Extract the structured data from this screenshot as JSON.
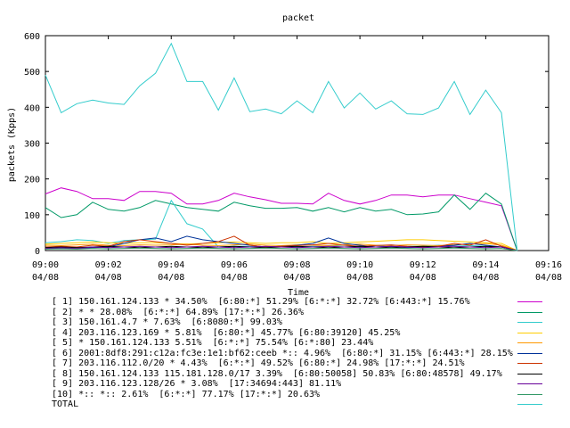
{
  "chart_data": {
    "type": "line",
    "title": "packet",
    "xlabel": "Time",
    "ylabel": "packets (Kpps)",
    "ylim": [
      0,
      600
    ],
    "yticks": [
      "0",
      "100",
      "200",
      "300",
      "400",
      "500",
      "600"
    ],
    "xlim": [
      "04/08 09:00",
      "04/08 09:16"
    ],
    "xticks": [
      {
        "time": "09:00",
        "date": "04/08"
      },
      {
        "time": "09:02",
        "date": "04/08"
      },
      {
        "time": "09:04",
        "date": "04/08"
      },
      {
        "time": "09:06",
        "date": "04/08"
      },
      {
        "time": "09:08",
        "date": "04/08"
      },
      {
        "time": "09:10",
        "date": "04/08"
      },
      {
        "time": "09:12",
        "date": "04/08"
      },
      {
        "time": "09:14",
        "date": "04/08"
      },
      {
        "time": "09:16",
        "date": "04/08"
      }
    ],
    "x": [
      "09:00:00",
      "09:00:30",
      "09:01:00",
      "09:01:30",
      "09:02:00",
      "09:02:30",
      "09:03:00",
      "09:03:30",
      "09:04:00",
      "09:04:30",
      "09:05:00",
      "09:05:30",
      "09:06:00",
      "09:06:30",
      "09:07:00",
      "09:07:30",
      "09:08:00",
      "09:08:30",
      "09:09:00",
      "09:09:30",
      "09:10:00",
      "09:10:30",
      "09:11:00",
      "09:11:30",
      "09:12:00",
      "09:12:30",
      "09:13:00",
      "09:13:30",
      "09:14:00",
      "09:14:30",
      "09:15:00"
    ],
    "grid": false,
    "legend_position": "bottom",
    "series": [
      {
        "name": "[ 1] 150.161.124.133 * 34.50%  [6:80:*] 51.29% [6:*:*] 32.72% [6:443:*] 15.76%",
        "color": "#cc00cc",
        "values": [
          158,
          175,
          165,
          145,
          145,
          140,
          165,
          165,
          160,
          130,
          130,
          140,
          160,
          150,
          142,
          132,
          132,
          130,
          160,
          140,
          130,
          140,
          155,
          155,
          150,
          155,
          155,
          145,
          135,
          125,
          0
        ]
      },
      {
        "name": "[ 2] * * 28.08%  [6:*:*] 64.89% [17:*:*] 26.36%",
        "color": "#009966",
        "values": [
          120,
          92,
          100,
          135,
          115,
          110,
          120,
          140,
          130,
          120,
          115,
          110,
          135,
          125,
          118,
          118,
          120,
          110,
          120,
          108,
          120,
          110,
          115,
          100,
          102,
          108,
          155,
          115,
          160,
          130,
          0
        ]
      },
      {
        "name": "[ 3] 150.161.4.7 * 7.63%  [6:8080:*] 99.03%",
        "color": "#33cccc",
        "values": [
          22,
          25,
          30,
          28,
          20,
          28,
          30,
          32,
          140,
          75,
          60,
          10,
          12,
          12,
          10,
          12,
          10,
          12,
          12,
          15,
          10,
          15,
          10,
          12,
          12,
          15,
          12,
          14,
          12,
          10,
          0
        ]
      },
      {
        "name": "[ 4] 203.116.123.169 * 5.81%  [6:80:*] 45.77% [6:80:39120] 45.25%",
        "color": "#ffcc00",
        "values": [
          18,
          20,
          22,
          24,
          22,
          20,
          22,
          22,
          20,
          18,
          20,
          22,
          24,
          22,
          20,
          22,
          22,
          25,
          20,
          22,
          24,
          26,
          28,
          30,
          30,
          28,
          26,
          24,
          22,
          20,
          0
        ]
      },
      {
        "name": "[ 5] * 150.161.124.133 5.51%  [6:*:*] 75.54% [6:*:80] 23.44%",
        "color": "#ff9900",
        "values": [
          15,
          14,
          16,
          18,
          15,
          14,
          16,
          15,
          16,
          18,
          15,
          14,
          16,
          18,
          15,
          14,
          16,
          15,
          14,
          16,
          18,
          15,
          14,
          16,
          15,
          14,
          16,
          18,
          20,
          15,
          0
        ]
      },
      {
        "name": "[ 6] 2001:8df8:291:c12a:fc3e:1e1:bf62:ceeb *:: 4.96%  [6:80:*] 31.15% [6:443:*] 28.15%",
        "color": "#003399",
        "values": [
          5,
          6,
          5,
          8,
          10,
          20,
          30,
          35,
          25,
          40,
          30,
          25,
          20,
          15,
          10,
          12,
          15,
          20,
          35,
          20,
          15,
          10,
          12,
          8,
          10,
          12,
          15,
          20,
          15,
          10,
          0
        ]
      },
      {
        "name": "[ 7] 203.116.112.0/20 * 4.43%  [6:*:*] 49.52% [6:80:*] 24.98% [17:*:*] 24.51%",
        "color": "#cc3300",
        "values": [
          10,
          12,
          10,
          15,
          12,
          25,
          30,
          25,
          20,
          15,
          20,
          25,
          40,
          15,
          10,
          12,
          14,
          16,
          20,
          15,
          12,
          14,
          16,
          12,
          10,
          12,
          20,
          15,
          30,
          12,
          0
        ]
      },
      {
        "name": "[ 8] 150.161.124.133 115.181.128.0/17 3.39%  [6:80:50058] 50.83% [6:80:48578] 49.17%",
        "color": "#000000",
        "values": [
          8,
          10,
          8,
          10,
          12,
          10,
          8,
          10,
          12,
          10,
          8,
          10,
          12,
          10,
          8,
          10,
          12,
          10,
          8,
          10,
          12,
          10,
          8,
          10,
          12,
          10,
          8,
          10,
          12,
          10,
          0
        ]
      },
      {
        "name": "[ 9] 203.116.123.128/26 * 3.08%  [17:34694:443] 81.11%",
        "color": "#660099",
        "values": [
          6,
          8,
          6,
          10,
          8,
          10,
          12,
          10,
          8,
          10,
          12,
          10,
          8,
          10,
          12,
          10,
          8,
          10,
          12,
          10,
          8,
          10,
          12,
          10,
          8,
          10,
          12,
          10,
          8,
          10,
          0
        ]
      },
      {
        "name": "[10] *:: *:: 2.61%  [6:*:*] 77.17% [17:*:*] 20.63%",
        "color": "#339966",
        "values": [
          4,
          5,
          4,
          6,
          5,
          6,
          7,
          6,
          5,
          6,
          7,
          6,
          5,
          6,
          7,
          6,
          5,
          6,
          7,
          6,
          5,
          6,
          7,
          6,
          5,
          6,
          7,
          6,
          5,
          6,
          0
        ]
      },
      {
        "name": "TOTAL",
        "color": "#33cccc",
        "values": [
          490,
          385,
          410,
          420,
          412,
          408,
          460,
          495,
          578,
          472,
          472,
          392,
          482,
          388,
          395,
          382,
          418,
          385,
          472,
          398,
          440,
          395,
          418,
          382,
          380,
          398,
          472,
          380,
          448,
          385,
          0
        ]
      }
    ]
  }
}
